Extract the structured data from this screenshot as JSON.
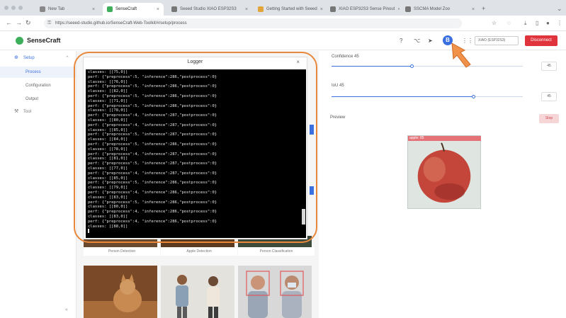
{
  "browser": {
    "tabs": [
      {
        "title": "New Tab",
        "active": false
      },
      {
        "title": "SenseCraft",
        "active": true
      },
      {
        "title": "Seeed Studio XIAO ESP32S3",
        "active": false
      },
      {
        "title": "Getting Started with Seeed",
        "active": false
      },
      {
        "title": "XIAO ESP32S3 Sense Pinout",
        "active": false
      },
      {
        "title": "SSCMA Model Zoo",
        "active": false
      }
    ],
    "url": "https://seeed-studio.github.io/SenseCraft-Web-Toolkit/#/setup/process"
  },
  "header": {
    "brand": "SenseCraft",
    "connected_badge": "B",
    "device_select": "XIAO (ESP32S3)",
    "connect_button": "Disconnect"
  },
  "sidebar": {
    "group_process": "Setup",
    "items": [
      "Process",
      "Configuration",
      "Output"
    ],
    "group_tool": "Tool"
  },
  "logger": {
    "title": "Logger",
    "lines": [
      "classes: [[75,0]]",
      "perf: {\"preprocess\":5, \"inference\":286,\"postprocess\":0}",
      "classes: [[76,0]]",
      "perf: {\"preprocess\":5, \"inference\":286,\"postprocess\":0}",
      "classes: [[82,0]]",
      "perf: {\"preprocess\":5, \"inference\":286,\"postprocess\":0}",
      "classes: [[71,0]]",
      "perf: {\"preprocess\":5, \"inference\":286,\"postprocess\":0}",
      "classes: [[78,0]]",
      "perf: {\"preprocess\":4, \"inference\":287,\"postprocess\":0}",
      "classes: [[80,0]]",
      "perf: {\"preprocess\":4, \"inference\":287,\"postprocess\":0}",
      "classes: [[85,0]]",
      "perf: {\"preprocess\":5, \"inference\":287,\"postprocess\":0}",
      "classes: [[84,0]]",
      "perf: {\"preprocess\":5, \"inference\":286,\"postprocess\":0}",
      "classes: [[78,0]]",
      "perf: {\"preprocess\":4, \"inference\":287,\"postprocess\":0}",
      "classes: [[81,0]]",
      "perf: {\"preprocess\":5, \"inference\":287,\"postprocess\":0}",
      "classes: [[77,0]]",
      "perf: {\"preprocess\":4, \"inference\":287,\"postprocess\":0}",
      "classes: [[85,0]]",
      "perf: {\"preprocess\":5, \"inference\":286,\"postprocess\":0}",
      "classes: [[79,0]]",
      "perf: {\"preprocess\":4, \"inference\":286,\"postprocess\":0}",
      "classes: [[83,0]]",
      "perf: {\"preprocess\":5, \"inference\":286,\"postprocess\":0}",
      "classes: [[80,0]]",
      "perf: {\"preprocess\":4, \"inference\":286,\"postprocess\":0}",
      "classes: [[83,0]]",
      "perf: {\"preprocess\":4, \"inference\":286,\"postprocess\":0}",
      "classes: [[88,0]]"
    ]
  },
  "model_cards": [
    "Person Detection",
    "Apple Detection",
    "Person Classification"
  ],
  "right_panel": {
    "confidence_label": "Confidence 45",
    "confidence_value": "45",
    "confidence_level": 0.42,
    "iou_label": "IoU 45",
    "iou_value": "45",
    "iou_level": 0.74,
    "preview_label": "Preview",
    "stop_button": "Stop",
    "detection_label": "apple: 85"
  },
  "colors": {
    "accent": "#3a6fe0",
    "danger": "#e0343c",
    "highlight": "#e8883c",
    "brand": "#3dae5a"
  }
}
